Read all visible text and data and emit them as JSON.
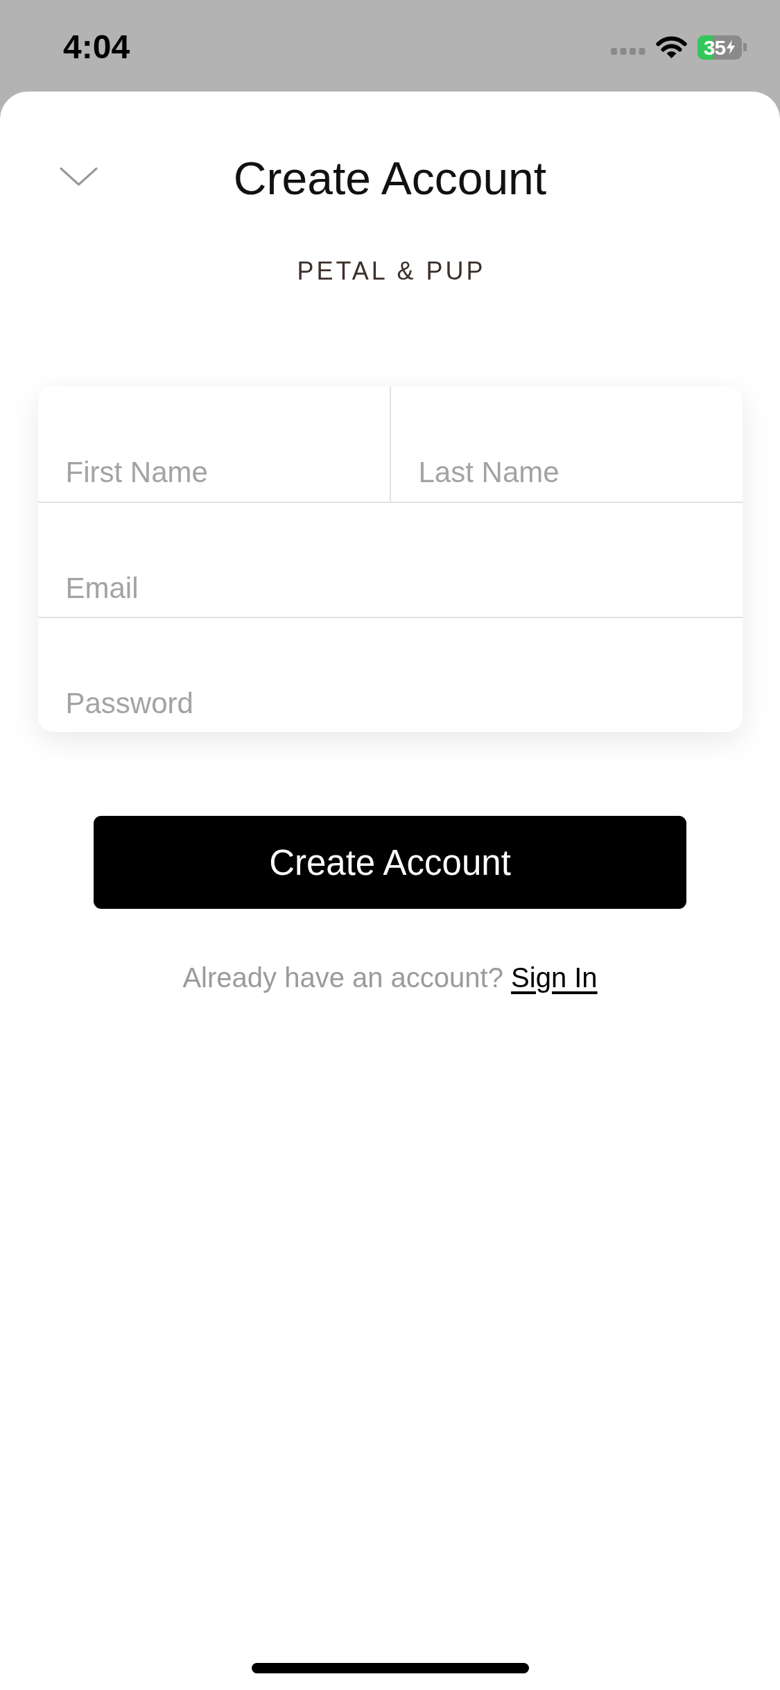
{
  "status_bar": {
    "time": "4:04",
    "battery_percent": "35",
    "charging": true
  },
  "header": {
    "title": "Create Account"
  },
  "brand": {
    "logo_text": "PETAL & PUP"
  },
  "form": {
    "rows": [
      {
        "fields": [
          {
            "placeholder": "First Name"
          },
          {
            "placeholder": "Last Name"
          }
        ]
      },
      {
        "fields": [
          {
            "placeholder": "Email"
          }
        ]
      },
      {
        "fields": [
          {
            "placeholder": "Password"
          }
        ]
      }
    ]
  },
  "primary_button": {
    "label": "Create Account"
  },
  "sign_in_prompt": {
    "text": "Already have an account?",
    "link": "Sign In"
  }
}
